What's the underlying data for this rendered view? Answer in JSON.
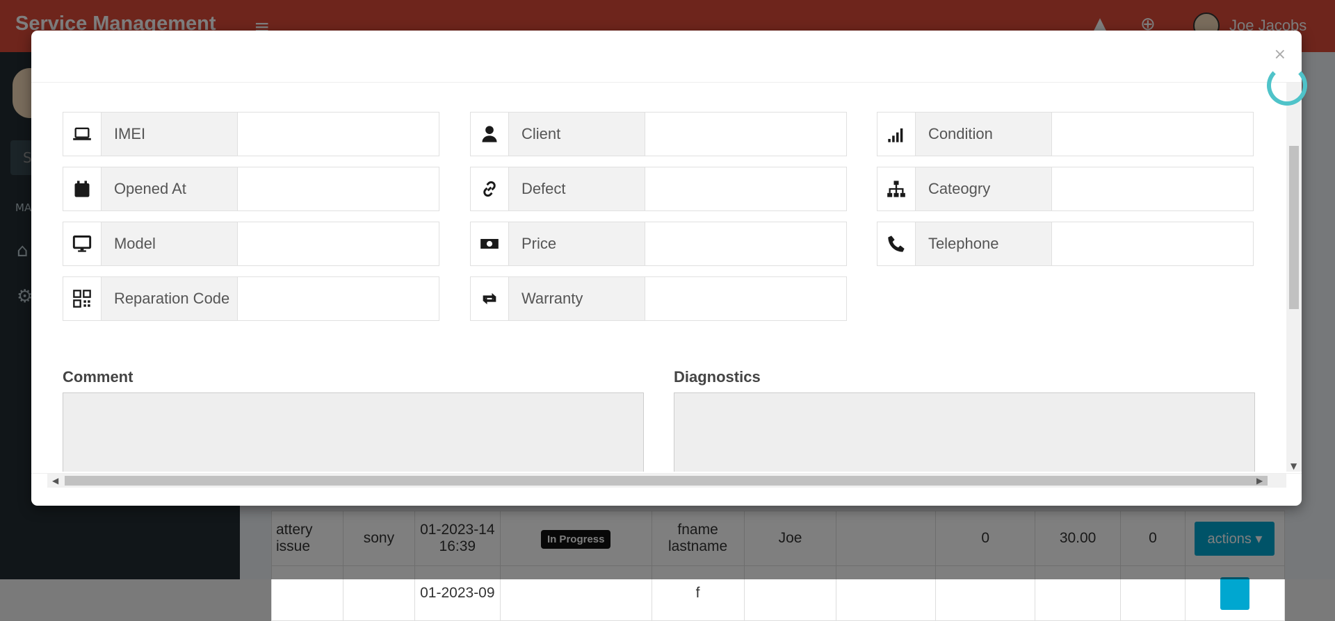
{
  "app": {
    "title": "Service Management",
    "menu_icon": "bars-icon"
  },
  "topbar": {
    "icons": [
      "warning-icon",
      "plus-circle-icon"
    ],
    "user_name": "Joe Jacobs"
  },
  "sidebar": {
    "search_placeholder": "S",
    "header": "MA",
    "items": [
      {
        "icon": "home-icon"
      },
      {
        "icon": "gear-icon"
      }
    ]
  },
  "table_rows": [
    {
      "description": "attery issue",
      "brand": "sony",
      "date": "01-2023-14 16:39",
      "status": "In Progress",
      "client": "fname lastname",
      "user": "Joe",
      "c1": "",
      "c2": "0",
      "price": "30.00",
      "c3": "0",
      "action": "actions"
    },
    {
      "description": "",
      "brand": "",
      "date": "01-2023-09",
      "status": "",
      "client": "f",
      "user": "",
      "c1": "",
      "c2": "",
      "price": "",
      "c3": "",
      "action": ""
    }
  ],
  "modal": {
    "close_label": "×",
    "fields": [
      {
        "icon": "laptop-icon",
        "label": "IMEI",
        "value": ""
      },
      {
        "icon": "user-icon",
        "label": "Client",
        "value": ""
      },
      {
        "icon": "signal-icon",
        "label": "Condition",
        "value": ""
      },
      {
        "icon": "calendar-icon",
        "label": "Opened At",
        "value": ""
      },
      {
        "icon": "link-icon",
        "label": "Defect",
        "value": ""
      },
      {
        "icon": "sitemap-icon",
        "label": "Cateogry",
        "value": ""
      },
      {
        "icon": "desktop-icon",
        "label": "Model",
        "value": ""
      },
      {
        "icon": "money-icon",
        "label": "Price",
        "value": ""
      },
      {
        "icon": "phone-icon",
        "label": "Telephone",
        "value": ""
      },
      {
        "icon": "qrcode-icon",
        "label": "Reparation Code",
        "value": ""
      },
      {
        "icon": "retweet-icon",
        "label": "Warranty",
        "value": ""
      }
    ],
    "comment_label": "Comment",
    "diagnostics_label": "Diagnostics",
    "comment_value": "",
    "diagnostics_value": ""
  }
}
